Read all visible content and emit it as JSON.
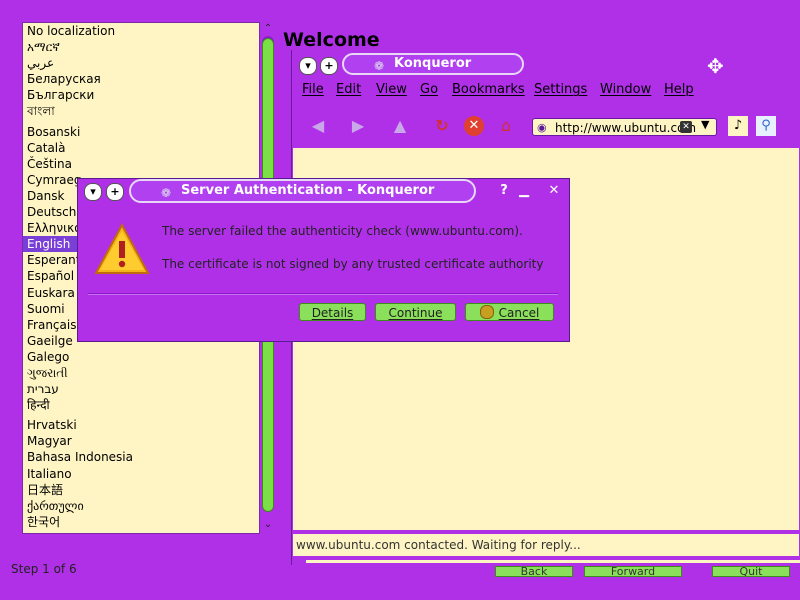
{
  "installer": {
    "languages": [
      "No localization",
      "አማርኛ",
      "عربي",
      "Беларуская",
      "Български",
      "বাংলা",
      "Bosanski",
      "Català",
      "Čeština",
      "Cymraeg",
      "Dansk",
      "Deutsch",
      "Ελληνικά",
      "English",
      "Esperanto",
      "Español",
      "Euskara",
      "Suomi",
      "Français",
      "Gaeilge",
      "Galego",
      "ગુજરાતી",
      "עברית",
      "हिन्दी",
      "Hrvatski",
      "Magyar",
      "Bahasa Indonesia",
      "Italiano",
      "日本語",
      "ქართული",
      "한국어"
    ],
    "selected_language": "English",
    "welcome_title": "Welcome",
    "step_label": "Step 1 of 6",
    "back_label": "Back",
    "forward_label": "Forward",
    "quit_label": "Quit"
  },
  "konqueror": {
    "title": "Konqueror",
    "menu": [
      "File",
      "Edit",
      "View",
      "Go",
      "Bookmarks",
      "Settings",
      "Window",
      "Help"
    ],
    "url": "http://www.ubuntu.com",
    "status": "www.ubuntu.com contacted. Waiting for reply..."
  },
  "dialog": {
    "title": "Server Authentication - Konqueror",
    "message1": "The server failed the authenticity check (www.ubuntu.com).",
    "message2": "The certificate is not signed by any trusted certificate authority",
    "details_label": "Details",
    "continue_label": "Continue",
    "cancel_label": "Cancel"
  },
  "colors": {
    "window_bg": "#b030e8",
    "content_bg": "#fff5c4",
    "button_green": "#8ae05a",
    "selection": "#7a3fd6"
  }
}
